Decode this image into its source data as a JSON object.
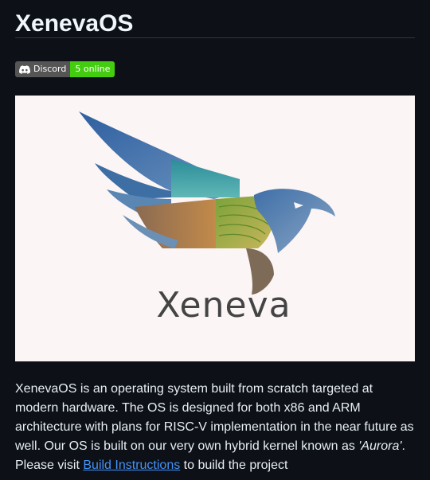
{
  "page": {
    "title": "XenevaOS"
  },
  "badge": {
    "left_label": "Discord",
    "right_label": "5 online",
    "icon": "discord-icon"
  },
  "hero": {
    "logo_text": "Xeneva",
    "icon": "bird-logo"
  },
  "description": {
    "text_before": "XenevaOS is an operating system built from scratch targeted at modern hardware. The OS is designed for both x86 and ARM architecture with plans for RISC-V implementation in the near future as well. Our OS is built on our very own hybrid kernel known as ",
    "kernel_name": "'Aurora'",
    "text_mid": ". Please visit ",
    "link_label": "Build Instructions",
    "text_after": " to build the project"
  },
  "colors": {
    "background": "#0d1117",
    "text": "#e6edf3",
    "link": "#4493f8",
    "badge_green": "#44cc11",
    "badge_gray": "#555555"
  }
}
